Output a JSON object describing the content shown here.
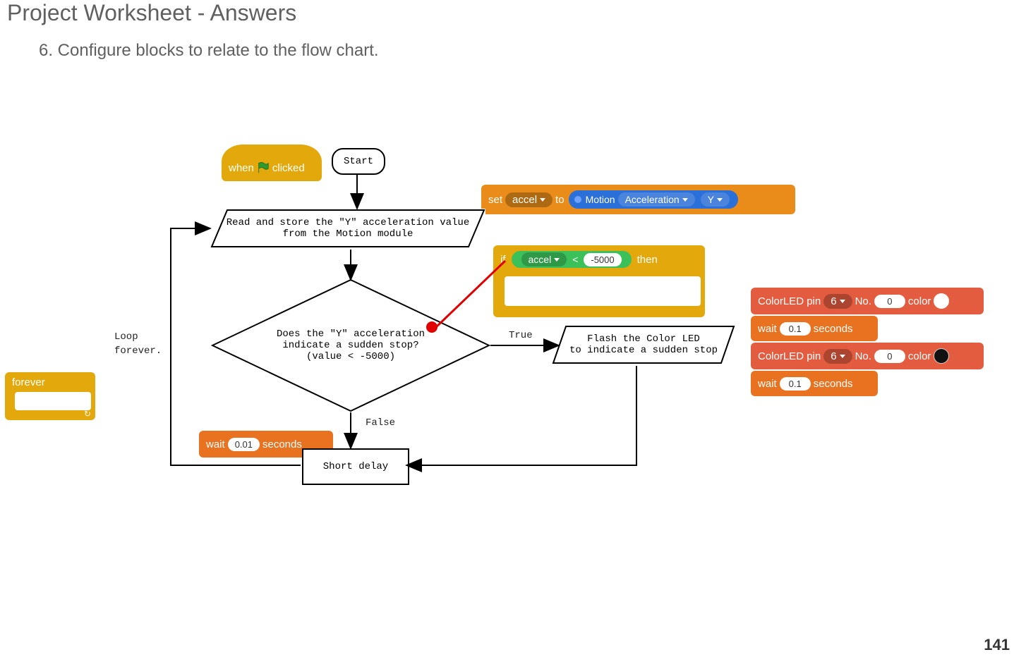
{
  "header": {
    "title": "Project Worksheet - Answers",
    "subtitle": "6. Configure blocks to relate to the flow chart.",
    "page_number": "141"
  },
  "blocks": {
    "when_clicked": {
      "prefix": "when",
      "suffix": "clicked"
    },
    "forever": "forever",
    "set_var": {
      "set": "set",
      "var": "accel",
      "to": "to",
      "sensor_prefix": "Motion",
      "sensor_type": "Acceleration",
      "axis": "Y"
    },
    "if_block": {
      "if": "if",
      "var": "accel",
      "op": "<",
      "val": "-5000",
      "then": "then"
    },
    "color_led": {
      "label_prefix": "ColorLED pin",
      "pin": "6",
      "no_label": "No.",
      "no_val": "0",
      "color_label": "color"
    },
    "wait": {
      "label": "wait",
      "secs": "seconds",
      "v1": "0.1",
      "v2": "0.1",
      "short": "0.01"
    }
  },
  "flowchart": {
    "start": "Start",
    "read": {
      "l1": "Read and store the \"Y\" acceleration value",
      "l2": "from the Motion module"
    },
    "decision": {
      "l1": "Does the \"Y\" acceleration",
      "l2": "indicate a sudden stop?",
      "l3": "(value < -5000)"
    },
    "flash": {
      "l1": "Flash the Color LED",
      "l2": "to indicate a sudden stop"
    },
    "delay": "Short delay",
    "loop_label_l1": "Loop",
    "loop_label_l2": "forever.",
    "true": "True",
    "false": "False"
  },
  "colors": {
    "white_swatch": "#ffffff",
    "black_swatch": "#111111"
  }
}
